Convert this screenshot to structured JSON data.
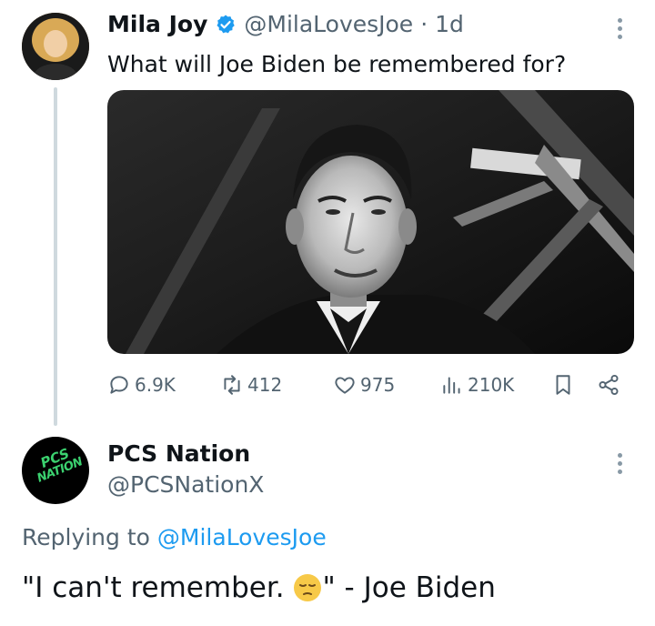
{
  "tweet": {
    "author_name": "Mila Joy",
    "author_handle": "@MilaLovesJoe",
    "separator": "·",
    "time": "1d",
    "text": "What will Joe Biden be remembered for?",
    "verified_color": "#1d9bf0",
    "actions": {
      "replies": "6.9K",
      "retweets": "412",
      "likes": "975",
      "views": "210K"
    }
  },
  "reply": {
    "author_name": "PCS Nation",
    "author_handle": "@PCSNationX",
    "avatar_text_line1": "PCS",
    "avatar_text_line2": "NATION",
    "replying_prefix": "Replying to",
    "replying_to": "@MilaLovesJoe",
    "text_before_emoji": "\"I can't remember. ",
    "emoji": "😔",
    "text_after_emoji": "\" - Joe Biden"
  },
  "colors": {
    "accent": "#1d9bf0",
    "secondary_text": "#536471",
    "avatar_text": "#3bd16f"
  }
}
